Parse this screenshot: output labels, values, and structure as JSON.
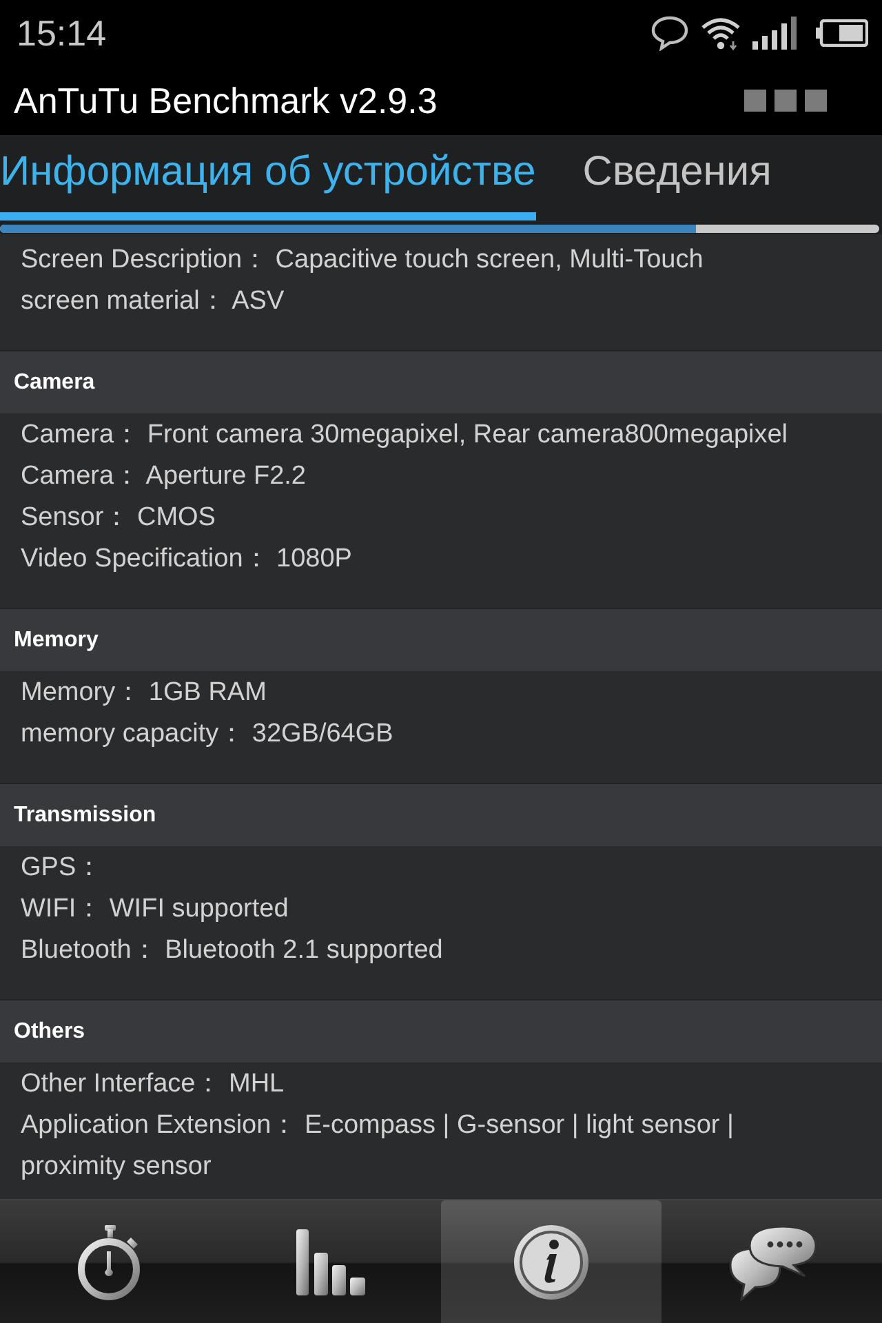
{
  "status_bar": {
    "time": "15:14"
  },
  "app_bar": {
    "title": "AnTuTu Benchmark v2.9.3"
  },
  "tabs": [
    {
      "label": "Информация об устройстве",
      "selected": true
    },
    {
      "label": "Сведения",
      "selected": false
    }
  ],
  "sections": [
    {
      "rows": [
        "Screen Description：  Capacitive touch screen, Multi-Touch",
        "screen material：  ASV"
      ]
    },
    {
      "title": "Camera",
      "rows": [
        "Camera：  Front camera 30megapixel, Rear camera800megapixel",
        "Camera：  Aperture F2.2",
        "Sensor：  CMOS",
        "Video Specification：  1080P"
      ]
    },
    {
      "title": "Memory",
      "rows": [
        "Memory：  1GB RAM",
        "memory capacity：  32GB/64GB"
      ]
    },
    {
      "title": "Transmission",
      "rows": [
        "GPS：",
        "WIFI：  WIFI supported",
        "Bluetooth：  Bluetooth 2.1 supported"
      ]
    },
    {
      "title": "Others",
      "rows": [
        "Other Interface：  MHL",
        "Application Extension：  E-compass | G-sensor | light sensor | proximity sensor"
      ]
    }
  ],
  "bottom_nav": [
    {
      "selected": false
    },
    {
      "selected": false
    },
    {
      "selected": true
    },
    {
      "selected": false
    }
  ]
}
